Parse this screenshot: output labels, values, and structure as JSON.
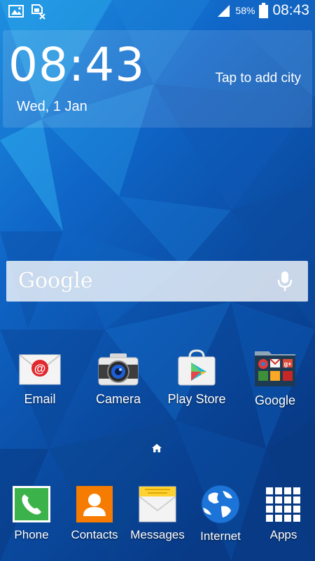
{
  "status_bar": {
    "battery_percent": "58%",
    "time": "08:43",
    "icons": [
      "gallery-notification-icon",
      "sim-card-notification-icon",
      "signal-icon",
      "battery-icon"
    ]
  },
  "clock_widget": {
    "time": "08:43",
    "date": "Wed, 1 Jan",
    "city_prompt": "Tap to add city"
  },
  "search": {
    "logo": "Google",
    "icons": [
      "mic-icon"
    ]
  },
  "home_apps": [
    {
      "label": "Email",
      "icon": "email-icon"
    },
    {
      "label": "Camera",
      "icon": "camera-icon"
    },
    {
      "label": "Play Store",
      "icon": "play-store-icon"
    },
    {
      "label": "Google",
      "icon": "google-folder-icon"
    }
  ],
  "page_indicator": {
    "icon": "home-icon"
  },
  "dock": [
    {
      "label": "Phone",
      "icon": "phone-icon"
    },
    {
      "label": "Contacts",
      "icon": "contacts-icon"
    },
    {
      "label": "Messages",
      "icon": "messages-icon"
    },
    {
      "label": "Internet",
      "icon": "internet-icon"
    },
    {
      "label": "Apps",
      "icon": "apps-grid-icon"
    }
  ],
  "colors": {
    "wallpaper_light": "#29a3e8",
    "wallpaper_mid": "#0d5bbf",
    "wallpaper_dark": "#083a86"
  }
}
